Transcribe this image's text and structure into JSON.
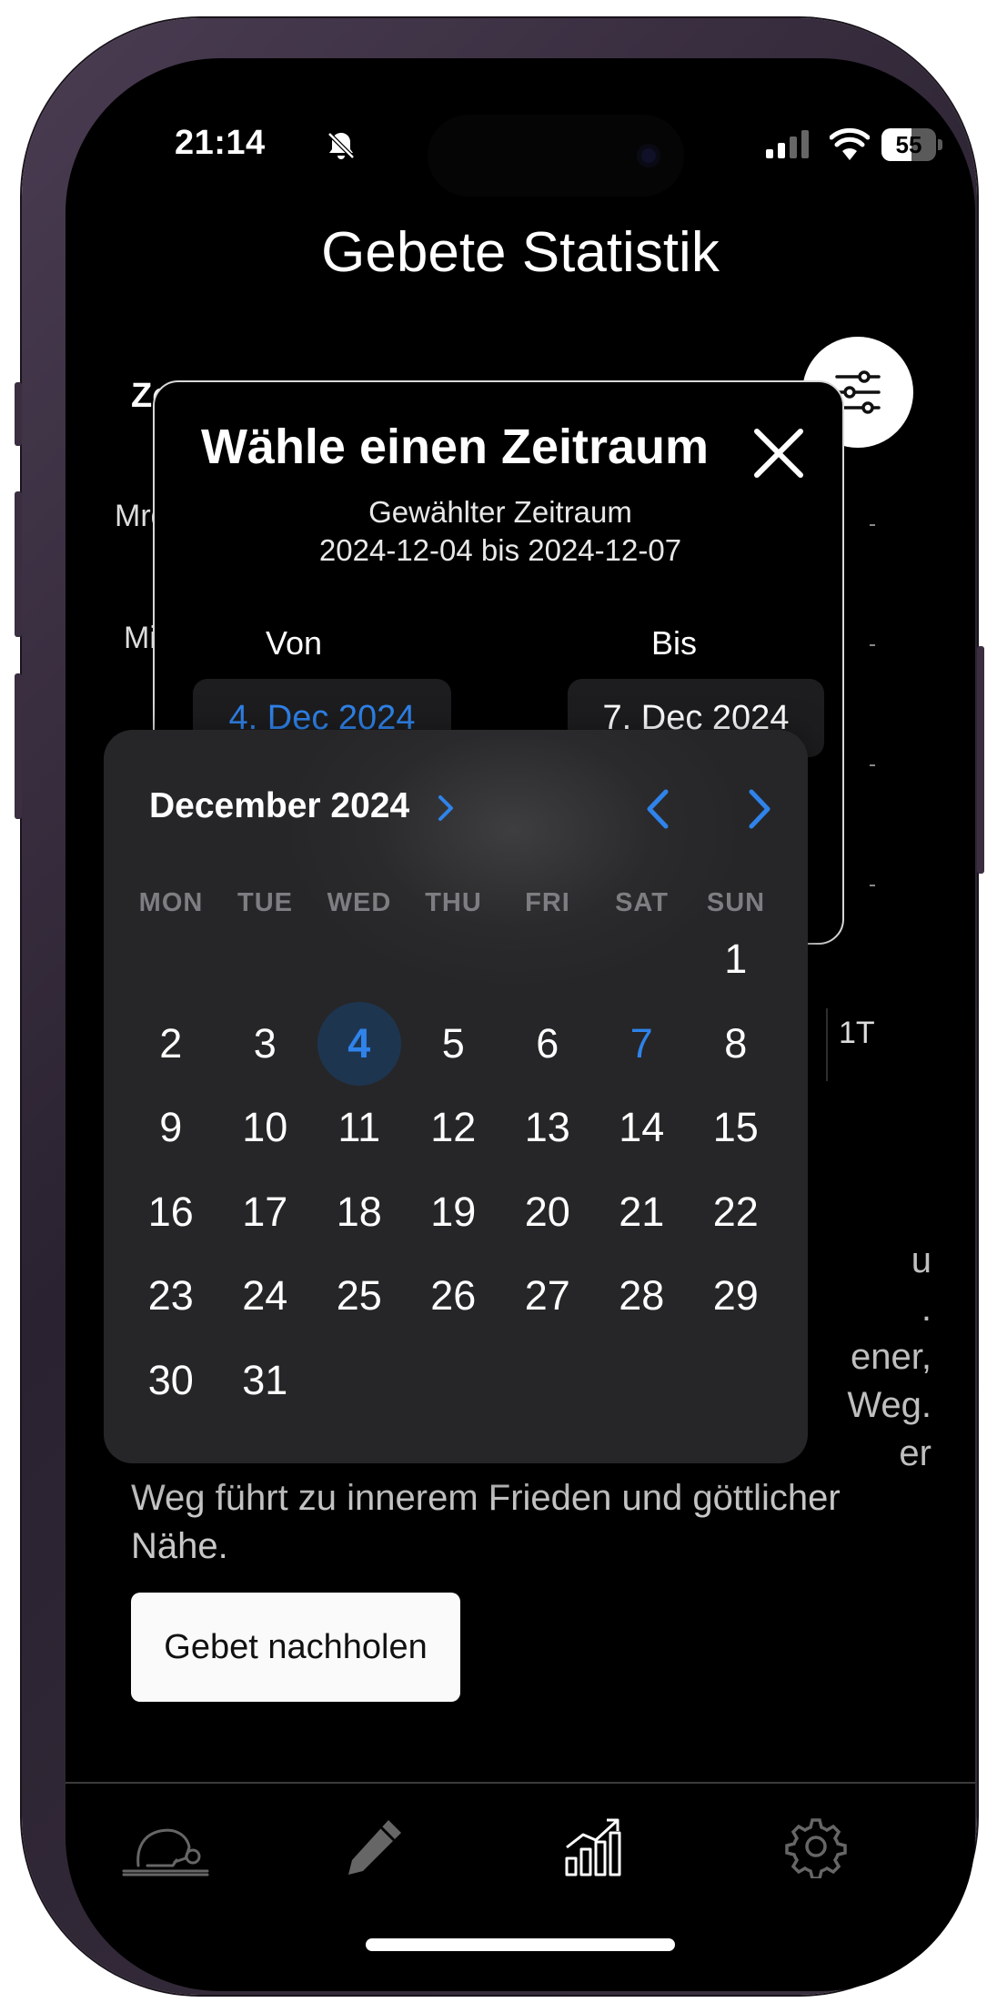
{
  "status_bar": {
    "time": "21:14",
    "battery_percent": "55",
    "battery_level": 0.55,
    "icons": [
      "bell-slash-icon",
      "signal-icon",
      "wifi-icon",
      "battery-icon"
    ]
  },
  "page": {
    "title": "Gebete Statistik",
    "background_fragments": {
      "zei": "Zei",
      "mrg": "Mrg",
      "mit": "Mit",
      "range_1t": "1T"
    },
    "text_fragments": [
      "u",
      ".",
      "ener,",
      "Weg.",
      "er"
    ],
    "body_text": "Weg führt zu innerem Frieden und göttlicher Nähe.",
    "catchup_button": "Gebet nachholen"
  },
  "modal": {
    "title": "Wähle einen Zeitraum",
    "subtitle": "Gewählter Zeitraum",
    "range": "2024-12-04 bis 2024-12-07",
    "from_label": "Von",
    "to_label": "Bis",
    "from_value": "4. Dec 2024",
    "to_value": "7. Dec 2024"
  },
  "calendar": {
    "month_label": "December 2024",
    "weekdays": [
      "MON",
      "TUE",
      "WED",
      "THU",
      "FRI",
      "SAT",
      "SUN"
    ],
    "first_weekday_index": 6,
    "days_in_month": 31,
    "selected_day": 4,
    "range_end_day": 7
  },
  "tab_bar": {
    "tabs": [
      "prayer-icon",
      "pencil-icon",
      "chart-icon",
      "gear-icon"
    ],
    "active": "chart-icon"
  },
  "colors": {
    "accent": "#2f83ea",
    "background": "#000000",
    "calendar_bg": "#2a2a2c",
    "button_bg": "#fafafa"
  }
}
